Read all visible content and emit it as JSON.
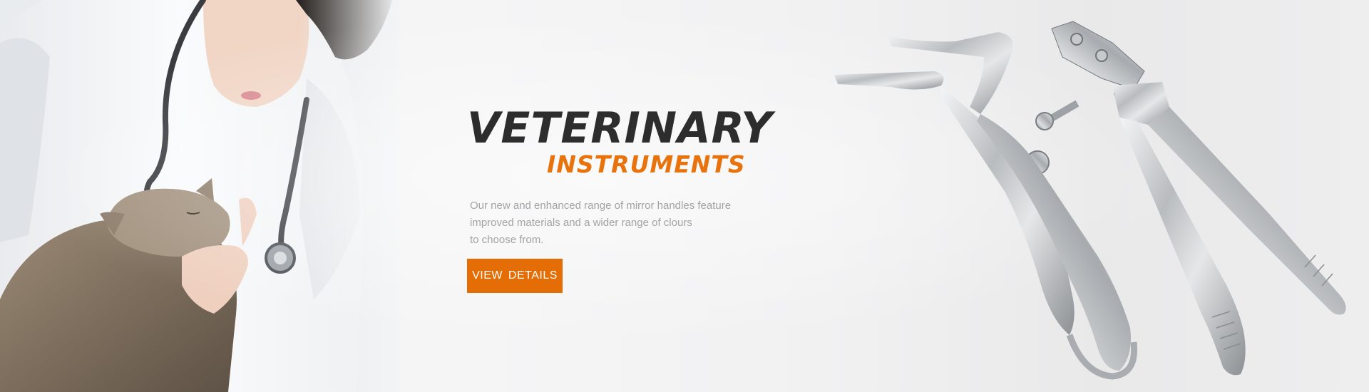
{
  "hero": {
    "title_main": "VETERINARY",
    "title_sub": "INSTRUMENTS",
    "description_lines": [
      "Our new and enhanced range of mirror handles feature",
      "improved materials and a wider range of clours",
      "to choose from."
    ],
    "cta_label": "VIEW  DETAILS"
  },
  "colors": {
    "accent": "#e56d05",
    "title": "#2d2d2d",
    "text_muted": "#a3a3a3",
    "background": "#f3f4f5"
  },
  "images": {
    "left_photo": "veterinarian-with-cat-photo",
    "right_photo": "surgical-instruments-photo"
  }
}
